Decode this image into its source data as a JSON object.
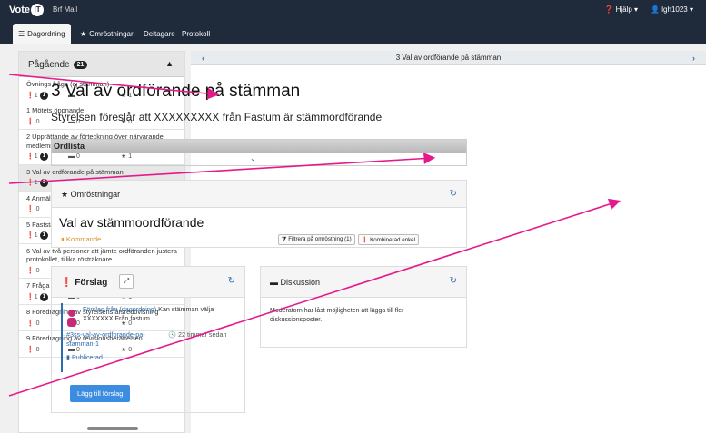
{
  "navbar": {
    "brand": "Vote",
    "brand_badge": "IT",
    "org": "Brf Mall",
    "help": "Hjälp",
    "user": "lgh1023"
  },
  "tabs": [
    {
      "label": "Dagordning",
      "icon": "list-icon"
    },
    {
      "label": "Omröstningar",
      "icon": "star-icon"
    },
    {
      "label": "Deltagare"
    },
    {
      "label": "Protokoll"
    }
  ],
  "sidebar": {
    "title": "Pågående",
    "count": "21",
    "items": [
      {
        "label": "Övnings fråga (ej stämman)",
        "a": "1",
        "b": "",
        "c": "1",
        "a_badge": "1"
      },
      {
        "label": "1 Mötets öppnande",
        "a": "0",
        "b": "0",
        "c": "0"
      },
      {
        "label": "2 Upprättande av förteckning över närvarande medlemmar, ombud och biträden (röstlängd)",
        "a": "1",
        "b": "0",
        "c": "1",
        "a_badge": "1"
      },
      {
        "label": "3 Val av ordförande på stämman",
        "a": "1",
        "b": "0",
        "c": "1",
        "a_badge": "1"
      },
      {
        "label": "4 Anmälan av ordförandens val av sekreterare",
        "a": "0",
        "b": "0",
        "c": "0"
      },
      {
        "label": "5 Fastställande av dagordningen",
        "a": "1",
        "b": "0",
        "c": "1",
        "a_badge": "1"
      },
      {
        "label": "6 Val av två personer att jämte ordföranden justera protokollet, tillika rösträknare",
        "a": "0",
        "b": "0",
        "c": "2"
      },
      {
        "label": "7 Fråga om kallelse till stämman behörigen skett",
        "a": "1",
        "b": "0",
        "c": "1",
        "a_badge": "1"
      },
      {
        "label": "8 Föredragning av styrelsens årsredovisning",
        "a": "0",
        "b": "0",
        "c": "0"
      },
      {
        "label": "9 Föredragning av revisionsberättelsen",
        "a": "0",
        "b": "0",
        "c": "0"
      }
    ]
  },
  "main": {
    "bar_title": "3 Val av ordförande på stämman",
    "title": "3 Val av ordförande på stämman",
    "subtitle": "Styrelsen föreslår att XXXXXXXXX från Fastum är stämmordförande",
    "glossary_title": "Ordlista",
    "votes": {
      "header": "Omröstningar",
      "title": "Val av stämmoordförande",
      "status": "Kommande",
      "filter_btn": "Filtrera på omröstning (1)",
      "combined_btn": "Kombinerad enkel"
    },
    "proposals": {
      "header": "Förslag",
      "source": "Förslag från (dagordning)",
      "text": " Kan stämman välja XXXXXXX Från fastum",
      "link": "#3ss-val-av-ordforande-pa-stamman-1",
      "time": "22 timmar sedan",
      "published": "Publicerad",
      "add_button": "Lägg till förslag"
    },
    "discussion": {
      "header": "Diskussion",
      "text": "Moderatorn har låst möjligheten att lägga till fler diskussionsposter."
    }
  },
  "colors": {
    "navbar": "#1f2a3a",
    "link": "#2a6db0",
    "status": "#e08a1e",
    "annotation": "#e6198c",
    "button": "#3c8ce0"
  }
}
